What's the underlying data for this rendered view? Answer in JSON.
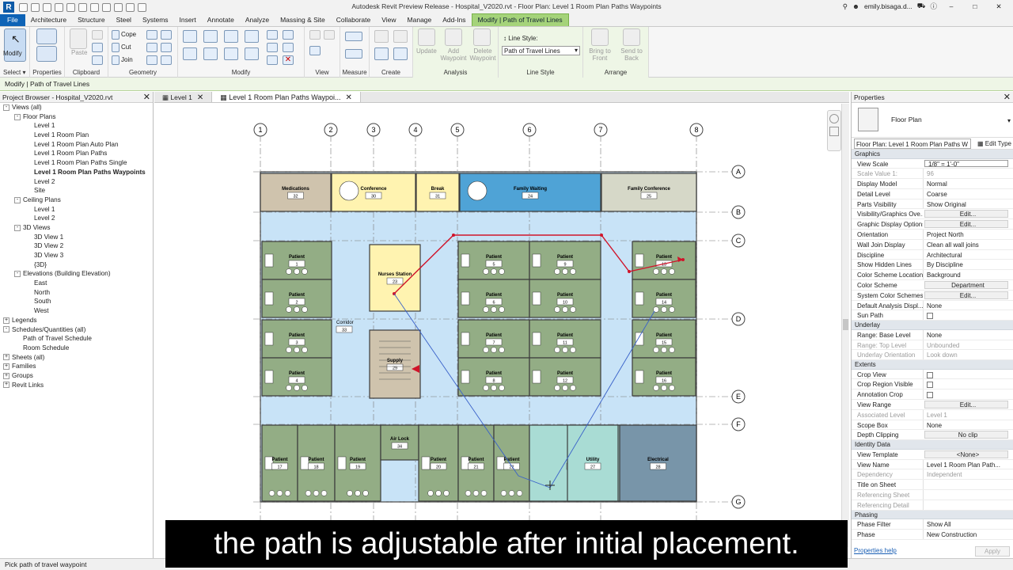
{
  "app": {
    "title": "Autodesk Revit Preview Release - Hospital_V2020.rvt - Floor Plan: Level 1 Room Plan Paths Waypoints",
    "user": "emily.bisaga.d...",
    "logo": "R"
  },
  "tabs": [
    "File",
    "Architecture",
    "Structure",
    "Steel",
    "Systems",
    "Insert",
    "Annotate",
    "Analyze",
    "Massing & Site",
    "Collaborate",
    "View",
    "Manage",
    "Add-Ins",
    "Modify | Path of Travel Lines"
  ],
  "ribbon": {
    "modify_label": "Modify",
    "paste_label": "Paste",
    "cope_label": "Cope",
    "cut_label": "Cut",
    "join_label": "Join",
    "update_label": "Update",
    "add_waypoint_label": "Add Waypoint",
    "delete_waypoint_label": "Delete Waypoint",
    "line_style_label": "Line Style:",
    "line_style_value": "Path of Travel Lines",
    "bring_to_front_label": "Bring to Front",
    "send_to_back_label": "Send to Back",
    "panels": {
      "select": "Select",
      "properties": "Properties",
      "clipboard": "Clipboard",
      "geometry": "Geometry",
      "modify": "Modify",
      "view": "View",
      "measure": "Measure",
      "create": "Create",
      "analysis": "Analysis",
      "line_style": "Line Style",
      "arrange": "Arrange"
    }
  },
  "options_bar": "Modify | Path of Travel Lines",
  "project_browser": {
    "title": "Project Browser - Hospital_V2020.rvt",
    "items": [
      {
        "label": "Views (all)",
        "level": 0,
        "exp": "-"
      },
      {
        "label": "Floor Plans",
        "level": 1,
        "exp": "-"
      },
      {
        "label": "Level 1",
        "level": 2
      },
      {
        "label": "Level 1 Room Plan",
        "level": 2
      },
      {
        "label": "Level 1 Room Plan Auto Plan",
        "level": 2
      },
      {
        "label": "Level 1 Room Plan Paths",
        "level": 2
      },
      {
        "label": "Level 1 Room Plan Paths Single",
        "level": 2
      },
      {
        "label": "Level 1 Room Plan Paths Waypoints",
        "level": 2,
        "bold": true
      },
      {
        "label": "Level 2",
        "level": 2
      },
      {
        "label": "Site",
        "level": 2
      },
      {
        "label": "Ceiling Plans",
        "level": 1,
        "exp": "-"
      },
      {
        "label": "Level 1",
        "level": 2
      },
      {
        "label": "Level 2",
        "level": 2
      },
      {
        "label": "3D Views",
        "level": 1,
        "exp": "-"
      },
      {
        "label": "3D View 1",
        "level": 2
      },
      {
        "label": "3D View 2",
        "level": 2
      },
      {
        "label": "3D View 3",
        "level": 2
      },
      {
        "label": "{3D}",
        "level": 2
      },
      {
        "label": "Elevations (Building Elevation)",
        "level": 1,
        "exp": "-"
      },
      {
        "label": "East",
        "level": 2
      },
      {
        "label": "North",
        "level": 2
      },
      {
        "label": "South",
        "level": 2
      },
      {
        "label": "West",
        "level": 2
      },
      {
        "label": "Legends",
        "level": 0,
        "exp": "+"
      },
      {
        "label": "Schedules/Quantities (all)",
        "level": 0,
        "exp": "-"
      },
      {
        "label": "Path of Travel Schedule",
        "level": 1
      },
      {
        "label": "Room Schedule",
        "level": 1
      },
      {
        "label": "Sheets (all)",
        "level": 0,
        "exp": "+"
      },
      {
        "label": "Families",
        "level": 0,
        "exp": "+"
      },
      {
        "label": "Groups",
        "level": 0,
        "exp": "+"
      },
      {
        "label": "Revit Links",
        "level": 0,
        "exp": "+"
      }
    ]
  },
  "view_tabs": [
    {
      "label": "Level 1",
      "active": false
    },
    {
      "label": "Level 1 Room Plan Paths Waypoi...",
      "active": true
    }
  ],
  "plan": {
    "grid_numbers": [
      "1",
      "2",
      "3",
      "4",
      "5",
      "6",
      "7",
      "8"
    ],
    "grid_letters": [
      "A",
      "B",
      "C",
      "D",
      "E",
      "F",
      "G"
    ],
    "rooms": [
      {
        "name": "Medications",
        "num": "32",
        "color": "#cfc3ad"
      },
      {
        "name": "Conference",
        "num": "30",
        "color": "#fff3b0"
      },
      {
        "name": "Break",
        "num": "31",
        "color": "#fff3b0"
      },
      {
        "name": "Family Waiting",
        "num": "24",
        "color": "#4fa3d6"
      },
      {
        "name": "Family Conference",
        "num": "25",
        "color": "#d6d8c8"
      },
      {
        "name": "Patient",
        "num": "1",
        "color": "#93ad85"
      },
      {
        "name": "Patient",
        "num": "2",
        "color": "#93ad85"
      },
      {
        "name": "Patient",
        "num": "3",
        "color": "#93ad85"
      },
      {
        "name": "Patient",
        "num": "4",
        "color": "#93ad85"
      },
      {
        "name": "Nurses Station",
        "num": "23",
        "color": "#fff3b0"
      },
      {
        "name": "Supply",
        "num": "29",
        "color": "#cfc3ad"
      },
      {
        "name": "Corridor",
        "num": "33",
        "color": "#c8e3f7"
      },
      {
        "name": "Patient",
        "num": "5",
        "color": "#93ad85"
      },
      {
        "name": "Patient",
        "num": "9",
        "color": "#93ad85"
      },
      {
        "name": "Patient",
        "num": "6",
        "color": "#93ad85"
      },
      {
        "name": "Patient",
        "num": "10",
        "color": "#93ad85"
      },
      {
        "name": "Patient",
        "num": "7",
        "color": "#93ad85"
      },
      {
        "name": "Patient",
        "num": "11",
        "color": "#93ad85"
      },
      {
        "name": "Patient",
        "num": "8",
        "color": "#93ad85"
      },
      {
        "name": "Patient",
        "num": "12",
        "color": "#93ad85"
      },
      {
        "name": "Patient",
        "num": "13",
        "color": "#93ad85"
      },
      {
        "name": "Patient",
        "num": "14",
        "color": "#93ad85"
      },
      {
        "name": "Patient",
        "num": "15",
        "color": "#93ad85"
      },
      {
        "name": "Patient",
        "num": "16",
        "color": "#93ad85"
      },
      {
        "name": "Patient",
        "num": "17",
        "color": "#93ad85"
      },
      {
        "name": "Patient",
        "num": "18",
        "color": "#93ad85"
      },
      {
        "name": "Patient",
        "num": "19",
        "color": "#93ad85"
      },
      {
        "name": "Air Lock",
        "num": "34",
        "color": "#93ad85"
      },
      {
        "name": "Patient",
        "num": "20",
        "color": "#93ad85"
      },
      {
        "name": "Patient",
        "num": "21",
        "color": "#93ad85"
      },
      {
        "name": "Patient",
        "num": "22",
        "color": "#93ad85"
      },
      {
        "name": "Utility",
        "num": "26",
        "color": "#a9dcd4"
      },
      {
        "name": "Utility",
        "num": "27",
        "color": "#a9dcd4"
      },
      {
        "name": "Electrical",
        "num": "28",
        "color": "#7895a9"
      }
    ]
  },
  "properties": {
    "title": "Properties",
    "type_name": "Floor Plan",
    "filter": "Floor Plan: Level 1 Room Plan Paths W",
    "edit_type": "Edit Type",
    "groups": [
      {
        "name": "Graphics",
        "rows": [
          {
            "k": "View Scale",
            "v": "1/8\" = 1'-0\"",
            "input": true
          },
          {
            "k": "Scale Value    1:",
            "v": "96",
            "dis": true
          },
          {
            "k": "Display Model",
            "v": "Normal"
          },
          {
            "k": "Detail Level",
            "v": "Coarse"
          },
          {
            "k": "Parts Visibility",
            "v": "Show Original"
          },
          {
            "k": "Visibility/Graphics Ove...",
            "v": "Edit...",
            "btn": true
          },
          {
            "k": "Graphic Display Options",
            "v": "Edit...",
            "btn": true
          },
          {
            "k": "Orientation",
            "v": "Project North"
          },
          {
            "k": "Wall Join Display",
            "v": "Clean all wall joins"
          },
          {
            "k": "Discipline",
            "v": "Architectural"
          },
          {
            "k": "Show Hidden Lines",
            "v": "By Discipline"
          },
          {
            "k": "Color Scheme Location",
            "v": "Background"
          },
          {
            "k": "Color Scheme",
            "v": "Department",
            "btn": true
          },
          {
            "k": "System Color Schemes",
            "v": "Edit...",
            "btn": true
          },
          {
            "k": "Default Analysis Displ...",
            "v": "None"
          },
          {
            "k": "Sun Path",
            "v": "",
            "chk": true
          }
        ]
      },
      {
        "name": "Underlay",
        "rows": [
          {
            "k": "Range: Base Level",
            "v": "None"
          },
          {
            "k": "Range: Top Level",
            "v": "Unbounded",
            "dis": true
          },
          {
            "k": "Underlay Orientation",
            "v": "Look down",
            "dis": true
          }
        ]
      },
      {
        "name": "Extents",
        "rows": [
          {
            "k": "Crop View",
            "v": "",
            "chk": true
          },
          {
            "k": "Crop Region Visible",
            "v": "",
            "chk": true
          },
          {
            "k": "Annotation Crop",
            "v": "",
            "chk": true
          },
          {
            "k": "View Range",
            "v": "Edit...",
            "btn": true
          },
          {
            "k": "Associated Level",
            "v": "Level 1",
            "dis": true
          },
          {
            "k": "Scope Box",
            "v": "None"
          },
          {
            "k": "Depth Clipping",
            "v": "No clip",
            "btn": true
          }
        ]
      },
      {
        "name": "Identity Data",
        "rows": [
          {
            "k": "View Template",
            "v": "<None>",
            "btn": true
          },
          {
            "k": "View Name",
            "v": "Level 1 Room Plan Path..."
          },
          {
            "k": "Dependency",
            "v": "Independent",
            "dis": true
          },
          {
            "k": "Title on Sheet",
            "v": ""
          },
          {
            "k": "Referencing Sheet",
            "v": "",
            "dis": true
          },
          {
            "k": "Referencing Detail",
            "v": "",
            "dis": true
          }
        ]
      },
      {
        "name": "Phasing",
        "rows": [
          {
            "k": "Phase Filter",
            "v": "Show All"
          },
          {
            "k": "Phase",
            "v": "New Construction"
          }
        ]
      }
    ],
    "help": "Properties help",
    "apply": "Apply"
  },
  "status": "Pick path of travel waypoint",
  "caption": "the path is adjustable after initial placement."
}
